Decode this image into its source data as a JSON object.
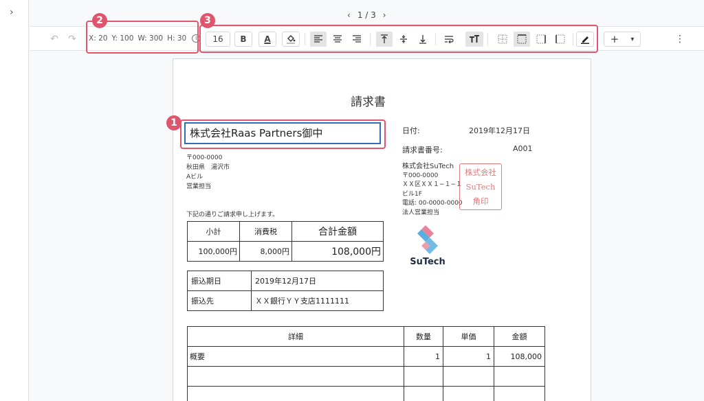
{
  "pager": {
    "prev": "‹",
    "label": "1 / 3",
    "next": "›"
  },
  "sidebar": {
    "expand_icon": "chevron-right-icon",
    "expand_glyph": "›"
  },
  "toolbar": {
    "undo": "↶",
    "redo": "↷",
    "x": "X: 20",
    "y": "Y: 100",
    "w": "W: 300",
    "h": "H: 30",
    "info_glyph": "i",
    "font_size": "16",
    "bold": "B",
    "font_color": "A",
    "add": "+",
    "dropdown": "▾",
    "more": "⋮"
  },
  "callouts": {
    "one": "1",
    "two": "2",
    "three": "3"
  },
  "colors": {
    "accent": "#e0556e",
    "selection": "#2f6db5",
    "stamp": "#e57a7a",
    "logo_blue": "#5aaee0",
    "logo_pink": "#e8839a"
  },
  "invoice": {
    "title": "請求書",
    "recipient": "株式会社Raas Partners御中",
    "recipient_addr": [
      "〒000-0000",
      "秋田県　湯沢市",
      "Aビル",
      "営業担当"
    ],
    "note": "下記の通りご請求申し上げます。",
    "summary": {
      "subtotal_label": "小計",
      "tax_label": "消費税",
      "total_label": "合計金額",
      "subtotal": "100,000円",
      "tax": "8,000円",
      "total": "108,000円"
    },
    "payment": {
      "due_label": "振込期日",
      "due": "2019年12月17日",
      "bank_label": "振込先",
      "bank": "ＸＸ銀行ＹＹ支店1111111"
    },
    "date_label": "日付:",
    "date": "2019年12月17日",
    "number_label": "請求書番号:",
    "number": "A001",
    "sender": {
      "company": "株式会社SuTech",
      "lines": [
        "〒000-0000",
        "ＸＸ区ＸＸ１−１−１",
        "ビル1F",
        "電話: 00-0000-0000",
        "法人営業担当"
      ]
    },
    "stamp": [
      "株式会社",
      "SuTech",
      "角印"
    ],
    "logo": "SuTech",
    "details": {
      "headers": {
        "item": "詳細",
        "qty": "数量",
        "unit": "単価",
        "amount": "金額"
      },
      "row1": {
        "item": "概要",
        "qty": "1",
        "unit": "1",
        "amount": "108,000"
      }
    }
  }
}
